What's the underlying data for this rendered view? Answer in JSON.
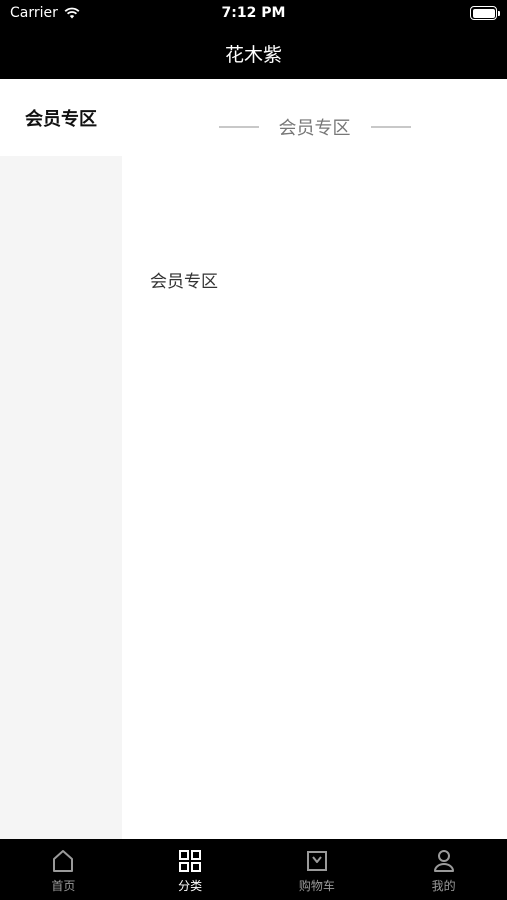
{
  "status_bar": {
    "carrier": "Carrier",
    "time": "7:12 PM"
  },
  "nav": {
    "title": "花木紫"
  },
  "sidebar": {
    "items": [
      {
        "label": "会员专区",
        "selected": true
      }
    ]
  },
  "content": {
    "section_title": "会员专区",
    "items": [
      {
        "label": "会员专区"
      }
    ]
  },
  "tabbar": {
    "items": [
      {
        "label": "首页",
        "icon": "home-icon",
        "active": false
      },
      {
        "label": "分类",
        "icon": "grid-icon",
        "active": true
      },
      {
        "label": "购物车",
        "icon": "cart-bag-icon",
        "active": false
      },
      {
        "label": "我的",
        "icon": "user-icon",
        "active": false
      }
    ]
  },
  "colors": {
    "bar_bg": "#000000",
    "sidebar_bg": "#f5f5f5",
    "active_tab": "#ffffff",
    "inactive_tab": "#9a9a9a"
  }
}
